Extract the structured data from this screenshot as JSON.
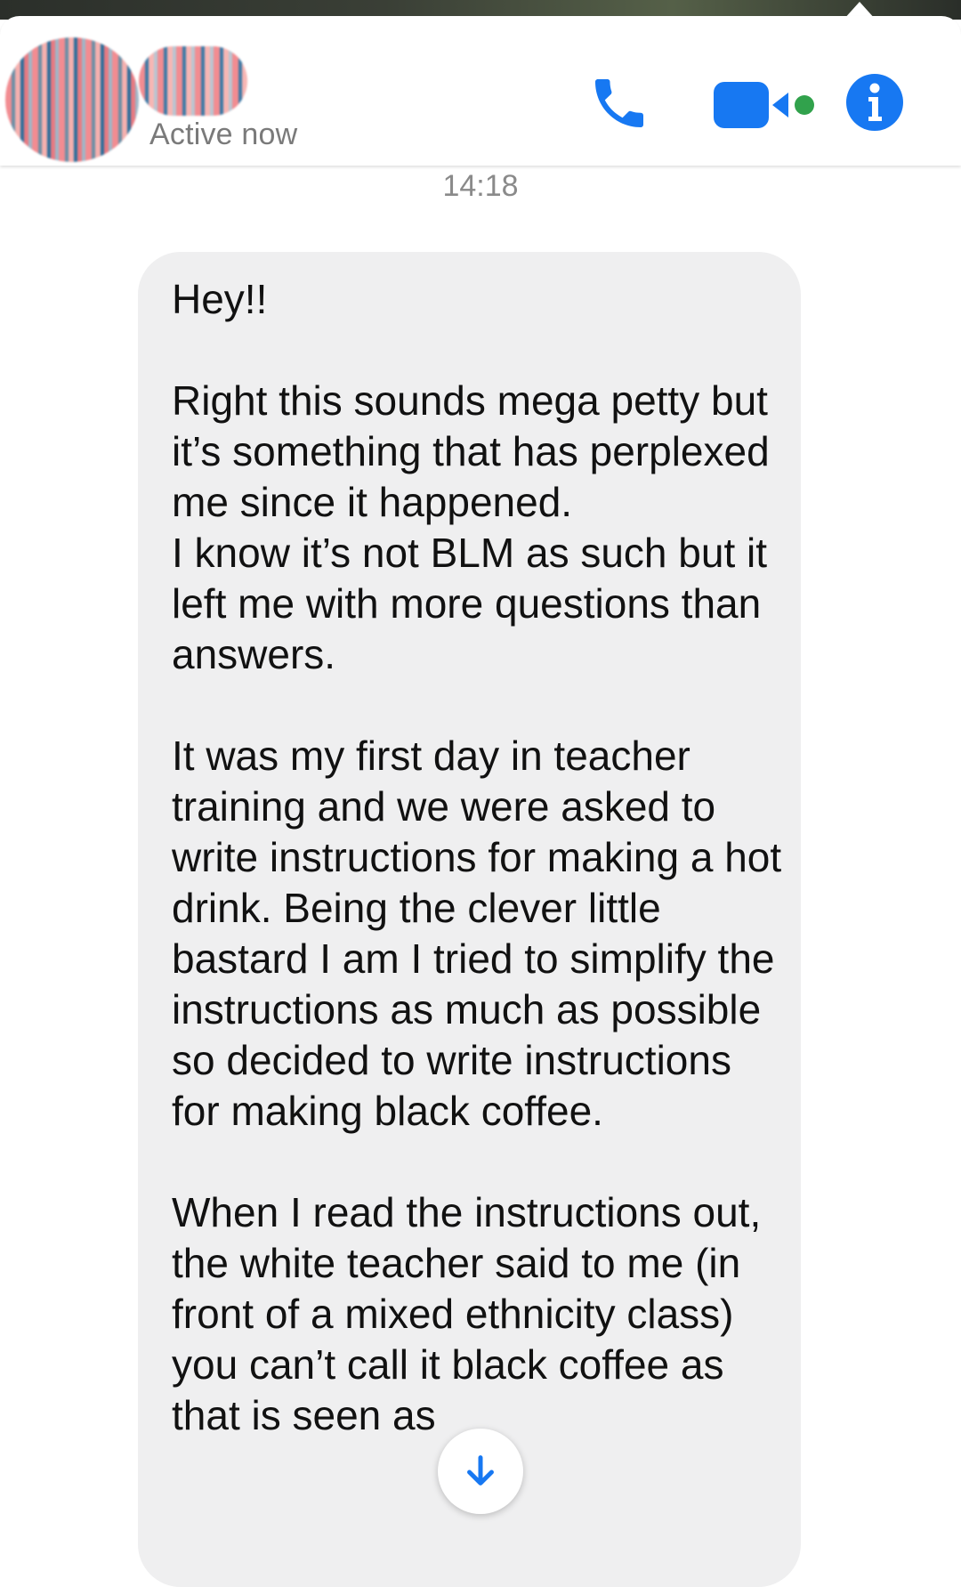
{
  "header": {
    "status": "Active now",
    "accent_color": "#1778f2",
    "active_dot_color": "#31a24c",
    "icons": [
      "phone-icon",
      "video-camera-icon",
      "info-icon"
    ]
  },
  "conversation": {
    "timestamp": "14:18",
    "message": {
      "paragraphs": [
        "Hey!!",
        "Right this sounds mega petty but it’s something that has perplexed me since it happened.\nI know it’s not BLM as such but it left me with more questions than answers.",
        "It was my first day in teacher training and we were asked to write instructions for making a hot drink. Being the clever little bastard I am I tried to simplify the instructions as much as possible so decided to write instructions for making black coffee.",
        "When I read the instructions out, the white teacher said to me (in front of a mixed ethnicity class) you can’t call it black coffee as that is seen as"
      ]
    }
  },
  "scroll_button": {
    "icon": "arrow-down-icon"
  }
}
